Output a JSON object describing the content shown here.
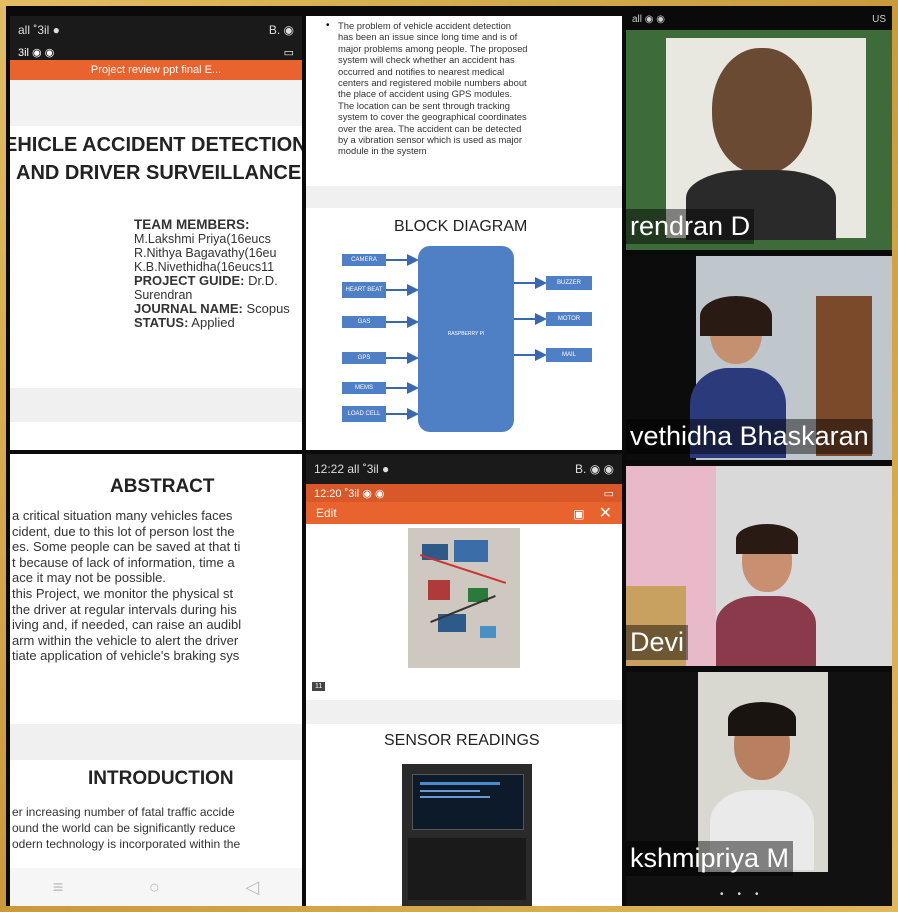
{
  "phone1": {
    "status_left": "all ˚3il ●",
    "status_right": "B. ◉",
    "status2_left": "3il ◉ ◉",
    "topbar": "Project review ppt final E...",
    "title_line1": "EHICLE ACCIDENT DETECTION",
    "title_line2": "AND DRIVER SURVEILLANCE",
    "team_heading": "TEAM MEMBERS:",
    "members": [
      "M.Lakshmi Priya(16eucs",
      "R.Nithya Bagavathy(16eu",
      "K.B.Nivethidha(16eucs11"
    ],
    "guide_label": "PROJECT GUIDE:",
    "guide_value": " Dr.D.",
    "guide_value2": "Surendran",
    "journal_label": "JOURNAL NAME:",
    "journal_value": " Scopus",
    "status_label": "STATUS:",
    "status_value": " Applied"
  },
  "phone2": {
    "abstract_title": "ABSTRACT",
    "abstract_lines": [
      "a critical situation many vehicles faces",
      "cident, due to this lot of person lost the",
      "es. Some people can be saved at that ti",
      "t because of lack of information, time a",
      "ace it may not be possible.",
      "this Project, we monitor the physical st",
      " the driver at regular intervals during his",
      "iving and, if needed, can raise an audibl",
      "arm within the vehicle to alert the driver",
      "tiate application of vehicle's braking sys"
    ],
    "intro_title": "INTRODUCTION",
    "intro_lines": [
      "er increasing number of fatal traffic accide",
      "ound the world can be significantly reduce",
      "odern technology is incorporated within the"
    ]
  },
  "phone3": {
    "bullet_text": [
      "The problem of vehicle accident detection",
      "has been an issue since long time and is of",
      "major problems among people. The proposed",
      "system will check whether an accident has",
      "occurred and notifies to nearest medical",
      "centers and registered mobile numbers about",
      "the place of accident using GPS modules.",
      "The location can be sent through tracking",
      "system to cover the geographical coordinates",
      "over the area. The accident can be detected",
      "by a vibration sensor which is used as major",
      "module in the system"
    ],
    "block_title": "BLOCK DIAGRAM",
    "inputs": [
      "CAMERA",
      "HEART BEAT",
      "GAS",
      "GPS",
      "MEMS",
      "LOAD CELL"
    ],
    "outputs": [
      "BUZZER",
      "MOTOR",
      "MAIL"
    ],
    "center": "RASPBERRY PI"
  },
  "phone4": {
    "status_left": "12:22 all ˚3il ●",
    "status_right": "B. ◉ ◉",
    "status2_left": "12:20 ˚3il ◉ ◉",
    "edit_label": "Edit",
    "slide_num": "11",
    "sensor_title": "SENSOR READINGS"
  },
  "video": {
    "top_status": "all ◉ ◉",
    "top_right": "US",
    "participants": [
      "rendran D",
      "vethidha Bhaskaran",
      "Devi",
      "kshmipriya M"
    ]
  }
}
